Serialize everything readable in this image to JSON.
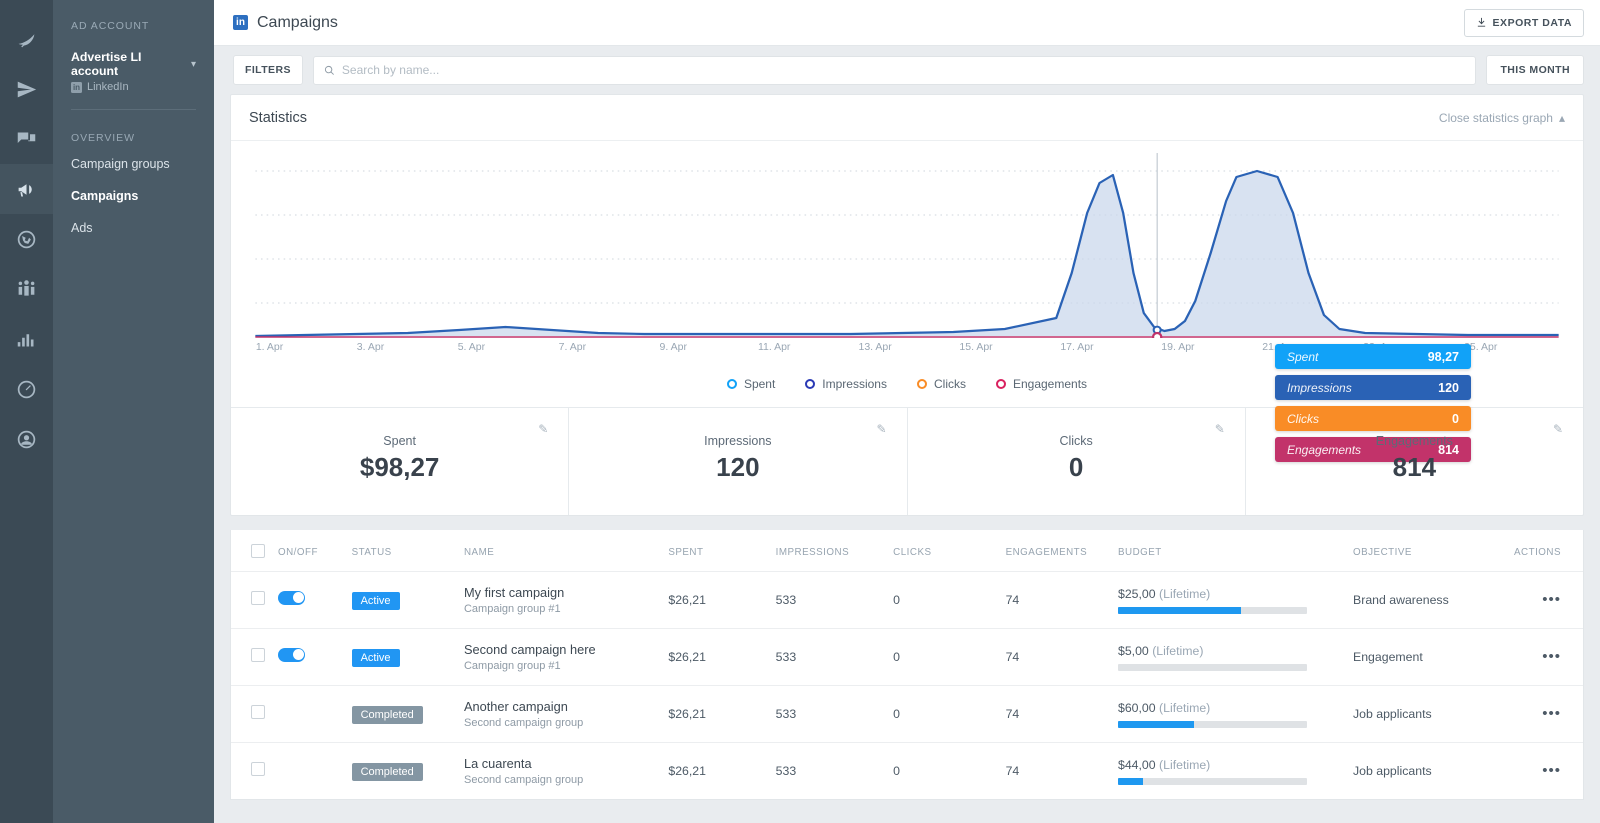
{
  "rail": {
    "items": [
      {
        "name": "feather-icon",
        "active": false
      },
      {
        "name": "send-icon",
        "active": false
      },
      {
        "name": "chat-icon",
        "active": false
      },
      {
        "name": "megaphone-icon",
        "active": true
      },
      {
        "name": "globe-icon",
        "active": false
      },
      {
        "name": "people-icon",
        "active": false
      },
      {
        "name": "bar-chart-icon",
        "active": false
      },
      {
        "name": "gauge-icon",
        "active": false
      },
      {
        "name": "user-add-icon",
        "active": false
      }
    ]
  },
  "sidebar": {
    "section_label": "AD ACCOUNT",
    "account_name": "Advertise LI account",
    "account_platform": "LinkedIn",
    "platform_badge": "in",
    "overview_label": "OVERVIEW",
    "nav": [
      {
        "label": "Campaign groups",
        "current": false
      },
      {
        "label": "Campaigns",
        "current": true
      },
      {
        "label": "Ads",
        "current": false
      }
    ]
  },
  "topbar": {
    "brand_badge": "in",
    "title": "Campaigns",
    "export_label": "EXPORT DATA"
  },
  "filterbar": {
    "filters_label": "FILTERS",
    "search_placeholder": "Search by name...",
    "search_value": "",
    "date_range_label": "THIS MONTH"
  },
  "statistics": {
    "title": "Statistics",
    "close_label": "Close statistics graph",
    "tooltip": [
      {
        "label": "Spent",
        "value": "98,27",
        "color": "#11a2f8"
      },
      {
        "label": "Impressions",
        "value": "120",
        "color": "#2a62b5"
      },
      {
        "label": "Clicks",
        "value": "0",
        "color": "#f98c26"
      },
      {
        "label": "Engagements",
        "value": "814",
        "color": "#c2336a"
      }
    ]
  },
  "chart_data": {
    "type": "area",
    "title": "Statistics",
    "xlabel": "",
    "ylabel": "",
    "grid": true,
    "legend_position": "bottom",
    "x": [
      "1. Apr",
      "2. Apr",
      "3. Apr",
      "4. Apr",
      "5. Apr",
      "6. Apr",
      "7. Apr",
      "8. Apr",
      "9. Apr",
      "10. Apr",
      "11. Apr",
      "12. Apr",
      "13. Apr",
      "14. Apr",
      "15. Apr",
      "16. Apr",
      "17. Apr",
      "18. Apr",
      "19. Apr",
      "20. Apr",
      "21. Apr",
      "22. Apr",
      "23. Apr",
      "24. Apr",
      "25. Apr"
    ],
    "tick_labels": [
      "1. Apr",
      "3. Apr",
      "5. Apr",
      "7. Apr",
      "9. Apr",
      "11. Apr",
      "13. Apr",
      "15. Apr",
      "17. Apr",
      "19. Apr",
      "21. Apr",
      "23. Apr",
      "25. Apr"
    ],
    "highlight_x": "19. Apr",
    "series": [
      {
        "name": "Spent",
        "color": "#11a2f8",
        "values": [
          0,
          0,
          0,
          0,
          0,
          0,
          0,
          0,
          0,
          0,
          0,
          0,
          0,
          0,
          0,
          0,
          0,
          0,
          98.27,
          0,
          0,
          0,
          0,
          0,
          0
        ]
      },
      {
        "name": "Impressions",
        "color": "#2a62b5",
        "values": [
          2,
          3,
          5,
          8,
          12,
          8,
          4,
          3,
          3,
          3,
          3,
          3,
          4,
          6,
          10,
          22,
          70,
          140,
          8,
          120,
          165,
          120,
          18,
          6,
          4
        ]
      },
      {
        "name": "Clicks",
        "color": "#f98c26",
        "values": [
          0,
          0,
          0,
          0,
          0,
          0,
          0,
          0,
          0,
          0,
          0,
          0,
          0,
          0,
          0,
          0,
          0,
          0,
          0,
          0,
          0,
          0,
          0,
          0,
          0
        ]
      },
      {
        "name": "Engagements",
        "color": "#c2336a",
        "values": [
          1,
          1,
          1,
          1,
          2,
          1,
          1,
          1,
          1,
          1,
          1,
          1,
          1,
          1,
          1,
          1,
          1,
          1,
          1,
          1,
          1,
          1,
          1,
          1,
          1
        ]
      }
    ],
    "ylim": [
      0,
      180
    ],
    "gridline_count": 4
  },
  "kpis": [
    {
      "label": "Spent",
      "value": "$98,27",
      "edit_icon": "pencil-icon"
    },
    {
      "label": "Impressions",
      "value": "120",
      "edit_icon": "pencil-icon"
    },
    {
      "label": "Clicks",
      "value": "0",
      "edit_icon": "pencil-icon"
    },
    {
      "label": "Engagements",
      "value": "814",
      "edit_icon": "pencil-icon"
    }
  ],
  "table": {
    "columns": [
      "",
      "ON/OFF",
      "STATUS",
      "NAME",
      "SPENT",
      "IMPRESSIONS",
      "CLICKS",
      "ENGAGEMENTS",
      "BUDGET",
      "OBJECTIVE",
      "ACTIONS"
    ],
    "rows": [
      {
        "toggle_on": true,
        "has_toggle": true,
        "status": "Active",
        "status_kind": "active",
        "name": "My first campaign",
        "group": "Campaign group #1",
        "spent": "$26,21",
        "impressions": "533",
        "clicks": "0",
        "engagements": "74",
        "budget_amount": "$25,00",
        "budget_type": "(Lifetime)",
        "budget_pct": 65,
        "objective": "Brand awareness"
      },
      {
        "toggle_on": true,
        "has_toggle": true,
        "status": "Active",
        "status_kind": "active",
        "name": "Second campaign here",
        "group": "Campaign group #1",
        "spent": "$26,21",
        "impressions": "533",
        "clicks": "0",
        "engagements": "74",
        "budget_amount": "$5,00",
        "budget_type": "(Lifetime)",
        "budget_pct": 0,
        "objective": "Engagement"
      },
      {
        "toggle_on": false,
        "has_toggle": false,
        "status": "Completed",
        "status_kind": "completed",
        "name": "Another campaign",
        "group": "Second campaign group",
        "spent": "$26,21",
        "impressions": "533",
        "clicks": "0",
        "engagements": "74",
        "budget_amount": "$60,00",
        "budget_type": "(Lifetime)",
        "budget_pct": 40,
        "objective": "Job applicants"
      },
      {
        "toggle_on": false,
        "has_toggle": false,
        "status": "Completed",
        "status_kind": "completed",
        "name": "La cuarenta",
        "group": "Second campaign group",
        "spent": "$26,21",
        "impressions": "533",
        "clicks": "0",
        "engagements": "74",
        "budget_amount": "$44,00",
        "budget_type": "(Lifetime)",
        "budget_pct": 13,
        "objective": "Job applicants"
      }
    ]
  }
}
